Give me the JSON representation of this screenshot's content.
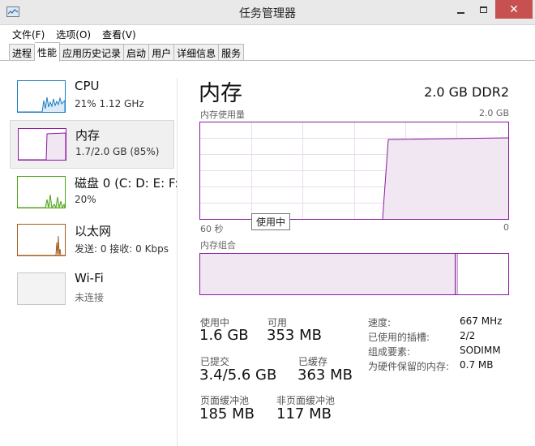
{
  "window": {
    "title": "任务管理器",
    "close_glyph": "✕"
  },
  "menu": [
    "文件(F)",
    "选项(O)",
    "查看(V)"
  ],
  "tabs": [
    "进程",
    "性能",
    "应用历史记录",
    "启动",
    "用户",
    "详细信息",
    "服务"
  ],
  "active_tab": "性能",
  "sidebar": {
    "items": [
      {
        "title": "CPU",
        "subtitle": "21% 1.12 GHz",
        "icon": "cpu-thumbnail",
        "color": "#1a7cc2"
      },
      {
        "title": "内存",
        "subtitle": "1.7/2.0 GB (85%)",
        "icon": "memory-thumbnail",
        "color": "#8b1a9e"
      },
      {
        "title": "磁盘 0 (C: D: E: F:",
        "subtitle": "20%",
        "icon": "disk-thumbnail",
        "color": "#4da319"
      },
      {
        "title": "以太网",
        "subtitle": "发送: 0 接收: 0 Kbps",
        "icon": "ethernet-thumbnail",
        "color": "#a75b1a"
      },
      {
        "title": "Wi-Fi",
        "subtitle": "未连接",
        "icon": "wifi-thumbnail",
        "color": "#b0b0b0"
      }
    ],
    "selected": "内存"
  },
  "main": {
    "title": "内存",
    "spec": "2.0 GB DDR2",
    "usage_graph": {
      "label": "内存使用量",
      "max_label": "2.0 GB",
      "time_start": "60 秒",
      "time_end": "0",
      "tooltip": "使用中",
      "color": "#8b1a9e"
    },
    "composition": {
      "label": "内存组合"
    },
    "stats": {
      "in_use_label": "使用中",
      "in_use": "1.6 GB",
      "available_label": "可用",
      "available": "353 MB",
      "committed_label": "已提交",
      "committed": "3.4/5.6 GB",
      "cached_label": "已缓存",
      "cached": "363 MB",
      "paged_pool_label": "页面缓冲池",
      "paged_pool": "185 MB",
      "nonpaged_pool_label": "非页面缓冲池",
      "nonpaged_pool": "117 MB"
    },
    "specs": [
      {
        "label": "速度:",
        "value": "667 MHz"
      },
      {
        "label": "已使用的插槽:",
        "value": "2/2"
      },
      {
        "label": "组成要素:",
        "value": "SODIMM"
      },
      {
        "label": "为硬件保留的内存:",
        "value": "0.7 MB"
      }
    ]
  }
}
